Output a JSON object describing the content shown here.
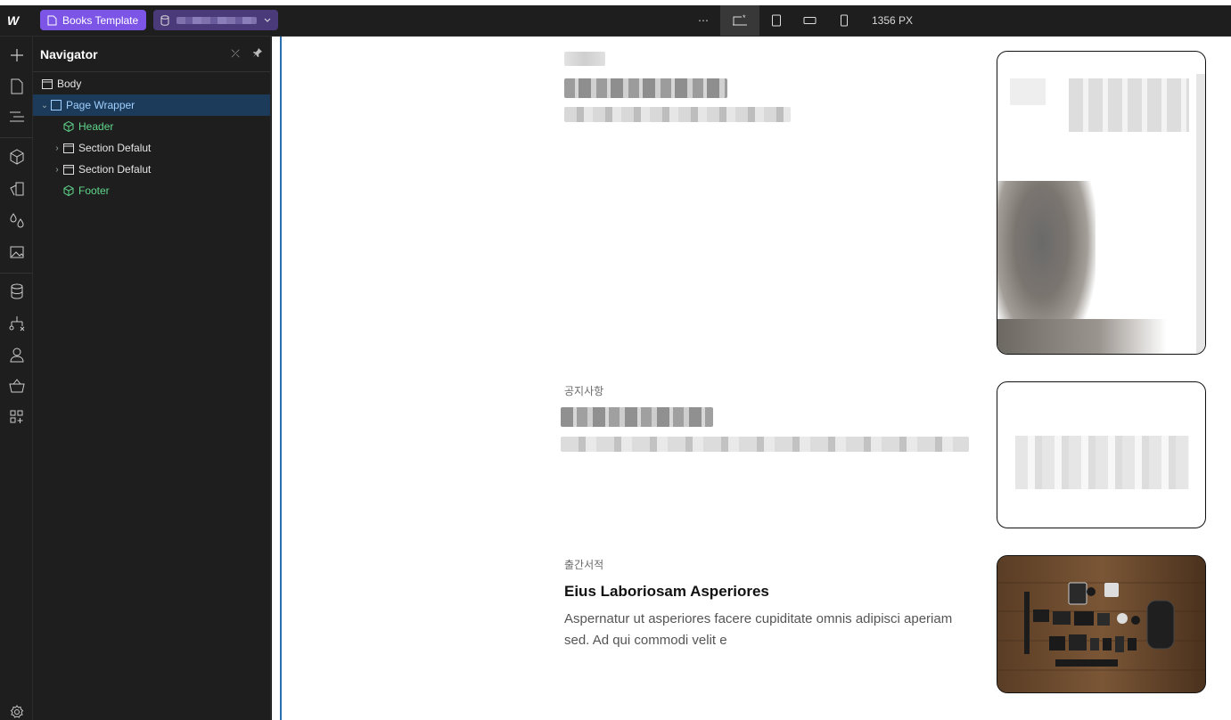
{
  "topbar": {
    "logo": "W",
    "site_name": "Books Template",
    "viewport_width": "1356 PX"
  },
  "navigator": {
    "title": "Navigator",
    "tree": [
      {
        "label": "Body",
        "type": "element",
        "indent": 0
      },
      {
        "label": "Page Wrapper",
        "type": "element",
        "indent": 0,
        "selected": true,
        "expanded": true
      },
      {
        "label": "Header",
        "type": "component",
        "indent": 1
      },
      {
        "label": "Section Defalut",
        "type": "element",
        "indent": 1,
        "collapsed": true
      },
      {
        "label": "Section Defalut",
        "type": "element",
        "indent": 1,
        "collapsed": true
      },
      {
        "label": "Footer",
        "type": "component",
        "indent": 1
      }
    ]
  },
  "canvas": {
    "posts": [
      {
        "category": "",
        "title": "",
        "excerpt": ""
      },
      {
        "category": "공지사항",
        "title": "",
        "excerpt": ""
      },
      {
        "category": "출간서적",
        "title": "Eius Laboriosam Asperiores",
        "excerpt": "Aspernatur ut asperiores facere cupiditate omnis adipisci aperiam sed. Ad qui commodi velit e"
      }
    ]
  },
  "colors": {
    "accent": "#7c55e6",
    "selection": "#1c3a59",
    "component": "#5fd68b",
    "chrome": "#1e1e1e"
  }
}
